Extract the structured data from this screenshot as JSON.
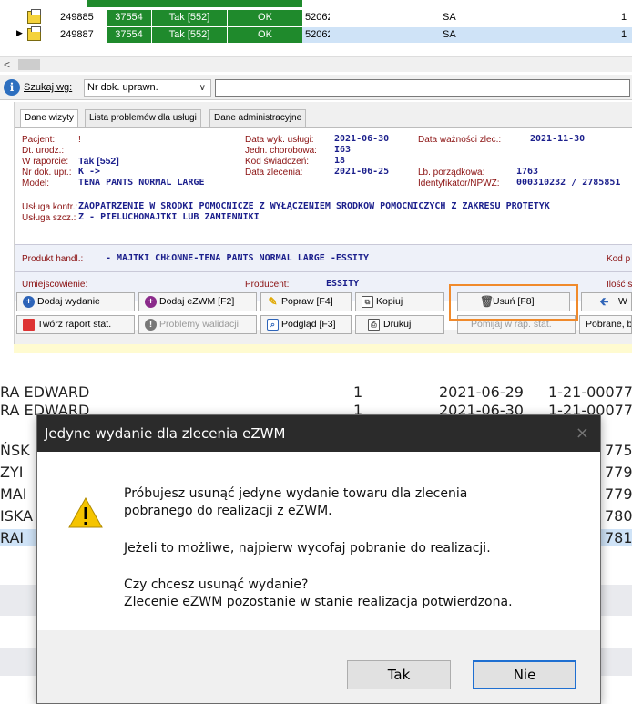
{
  "grid": {
    "rows": [
      {
        "id": "249885",
        "code": "37554",
        "status": "Tak [552]",
        "ok": "OK",
        "num": "52062",
        "sa": "SA",
        "qty": "1"
      },
      {
        "id": "249887",
        "code": "37554",
        "status": "Tak [552]",
        "ok": "OK",
        "num": "52062",
        "sa": "SA",
        "qty": "1"
      }
    ]
  },
  "search": {
    "info_icon": "i",
    "label": "Szukaj wg:",
    "selected": "Nr dok. uprawn."
  },
  "tabs": [
    "Dane wizyty",
    "Lista problemów dla usługi",
    "Dane administracyjne"
  ],
  "details": {
    "pacjent_label": "Pacjent:",
    "pacjent_value": "!",
    "dt_urodz_label": "Dt. urodz.:",
    "w_raporcie_label": "W raporcie:",
    "w_raporcie_value": "Tak [552]",
    "nr_dok_label": "Nr dok. upr.:",
    "nr_dok_value": "K ->",
    "model_label": "Model:",
    "model_value": "TENA PANTS NORMAL LARGE",
    "data_wyk_label": "Data wyk. usługi:",
    "data_wyk_value": "2021-06-30",
    "jedn_label": "Jedn. chorobowa:",
    "jedn_value": "I63",
    "kod_label": "Kod świadczeń:",
    "kod_value": "18",
    "data_zlec_label": "Data zlecenia:",
    "data_zlec_value": "2021-06-25",
    "data_waz_label": "Data ważności zlec.:",
    "data_waz_value": "2021-11-30",
    "lb_label": "Lb. porządkowa:",
    "lb_value": "1763",
    "ident_label": "Identyfikator/NPWZ:",
    "ident_value": "000310232 / 2785851",
    "usl_kontr_label": "Usługa kontr.:",
    "usl_kontr_value": "ZAOPATRZENIE W ŚRODKI POMOCNICZE Z WYŁĄCZENIEM ŚRODKÓW POMOCNICZYCH Z ZAKRESU PROTETYK",
    "usl_szcz_label": "Usługa szcz.:",
    "usl_szcz_value": "Z - PIELUCHOMAJTKI LUB ZAMIENNIKI",
    "produkt_label": "Produkt handl.:",
    "produkt_value": "- MAJTKI CHŁONNE-TENA PANTS NORMAL LARGE -ESSITY",
    "kod_p_label": "Kod p",
    "umiejsc_label": "Umiejscowienie:",
    "producent_label": "Producent:",
    "producent_value": "ESSITY",
    "ilosc_label": "Ilość s"
  },
  "buttons": {
    "dodaj_wydanie": "Dodaj wydanie",
    "dodaj_ezwm": "Dodaj eZWM [F2]",
    "popraw": "Popraw [F4]",
    "kopiuj": "Kopiuj",
    "usun": "Usuń [F8]",
    "w": "W",
    "tworz_raport": "Twórz raport stat.",
    "problemy": "Problemy walidacji",
    "podglad": "Podgląd [F3]",
    "drukuj": "Drukuj",
    "pomijaj": "Pomijaj w rap. stat.",
    "pobrane": "Pobrane, b"
  },
  "background_rows": [
    {
      "name": "RA EDWARD",
      "qty": "1",
      "date": "2021-06-29",
      "code": "1-21-00077"
    },
    {
      "name": "RA EDWARD",
      "qty": "1",
      "date": "2021-06-30",
      "code": "1-21-00077"
    },
    {
      "name": "ŃSK",
      "code": "775"
    },
    {
      "name": "ZYI",
      "code": "779"
    },
    {
      "name": "MAI",
      "code": "779"
    },
    {
      "name": "ISKA",
      "code": "780"
    },
    {
      "name": "RAI",
      "code": "781"
    }
  ],
  "dialog": {
    "title": "Jedyne wydanie dla zlecenia eZWM",
    "close_icon": "×",
    "line1": "Próbujesz usunąć jedyne wydanie towaru dla zlecenia",
    "line2": "pobranego do realizacji z eZWM.",
    "line3": "Jeżeli to możliwe, najpierw wycofaj pobranie do realizacji.",
    "line4": "Czy chcesz usunąć wydanie?",
    "line5": "Zlecenie eZWM pozostanie w stanie realizacja potwierdzona.",
    "yes": "Tak",
    "no": "Nie"
  },
  "colors": {
    "green": "#1f8a2c",
    "selection": "#cfe3f7",
    "highlight": "#f08a2c",
    "value_blue": "#1b1f8c",
    "label_red": "#8a1010"
  }
}
